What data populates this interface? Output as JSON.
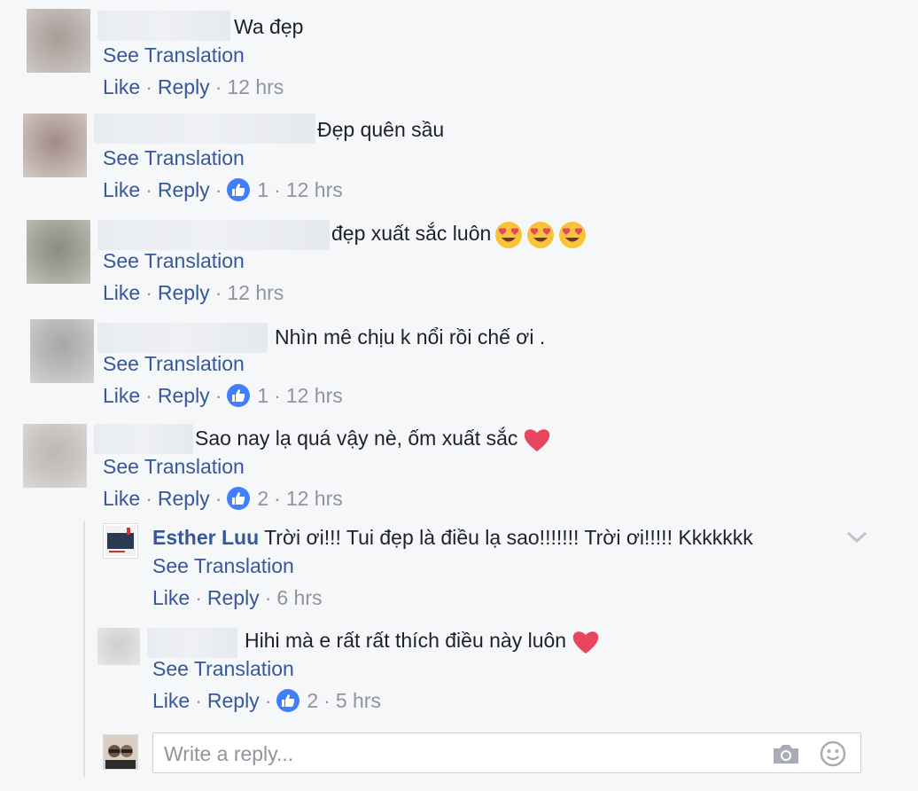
{
  "comments": [
    {
      "text": "Wa đẹp",
      "see_translation": "See Translation",
      "like": "Like",
      "reply": "Reply",
      "likes": "",
      "time": "12 hrs"
    },
    {
      "text": "Đẹp quên sầu",
      "see_translation": "See Translation",
      "like": "Like",
      "reply": "Reply",
      "likes": "1",
      "time": "12 hrs"
    },
    {
      "text": "đẹp xuất sắc luôn",
      "see_translation": "See Translation",
      "like": "Like",
      "reply": "Reply",
      "likes": "",
      "time": "12 hrs",
      "emojis": [
        "heart-eyes-emoji",
        "heart-eyes-emoji",
        "heart-eyes-emoji"
      ]
    },
    {
      "text": "Nhìn mê chịu k nổi rồi chế ơi .",
      "see_translation": "See Translation",
      "like": "Like",
      "reply": "Reply",
      "likes": "1",
      "time": "12 hrs"
    },
    {
      "text": "Sao nay lạ quá vậy nè, ốm xuất sắc",
      "see_translation": "See Translation",
      "like": "Like",
      "reply": "Reply",
      "likes": "2",
      "time": "12 hrs",
      "emojis": [
        "heart-emoji"
      ]
    }
  ],
  "replies": [
    {
      "author": "Esther Luu",
      "text": "Trời ơi!!! Tui đẹp là điều lạ sao!!!!!!! Trời ơi!!!!! Kkkkkkk",
      "see_translation": "See Translation",
      "like": "Like",
      "reply": "Reply",
      "likes": "",
      "time": "6 hrs"
    },
    {
      "author": "",
      "text": "Hihi mà e rất rất thích điều này luôn",
      "see_translation": "See Translation",
      "like": "Like",
      "reply": "Reply",
      "likes": "2",
      "time": "5 hrs",
      "emojis": [
        "heart-emoji"
      ]
    }
  ],
  "reply_box": {
    "placeholder": "Write a reply...",
    "icons": [
      "camera-icon",
      "smiley-icon"
    ]
  },
  "colors": {
    "link": "#365899",
    "meta": "#90949c",
    "like_badge": "#4080ff",
    "heart": "#e8455f"
  }
}
